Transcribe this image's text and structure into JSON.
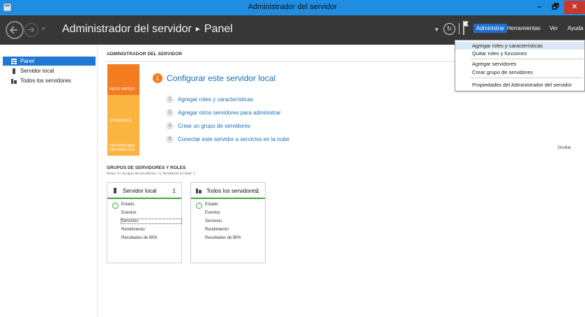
{
  "window": {
    "title": "Administrador del servidor"
  },
  "window_buttons": {
    "minimize": "–",
    "maximize": "🗗",
    "close": "✕"
  },
  "header": {
    "app_name": "Administrador del servidor",
    "separator": "▸",
    "page": "Panel",
    "menus": [
      "Administrar",
      "Herramientas",
      "Ver",
      "Ayuda"
    ]
  },
  "dropdown": {
    "items": [
      "Agregar roles y características",
      "Quitar roles y funciones",
      "Agregar servidores",
      "Crear grupo de servidores",
      "Propiedades del Administrador del servidor"
    ]
  },
  "sidebar": {
    "items": [
      {
        "label": "Panel",
        "icon": "dashboard-icon"
      },
      {
        "label": "Servidor local",
        "icon": "server-icon"
      },
      {
        "label": "Todos los servidores",
        "icon": "servers-icon"
      }
    ]
  },
  "main": {
    "title": "ADMINISTRADOR DEL SERVIDOR",
    "quick_start": {
      "tabs": [
        "INICIO RÁPIDO",
        "NOVEDADES",
        "OBTENER MÁS INFORMACIÓN"
      ],
      "main_step": {
        "num": "1",
        "label": "Configurar este servidor local"
      },
      "steps": [
        {
          "num": "2",
          "label": "Agregar roles y características"
        },
        {
          "num": "3",
          "label": "Agregar otros servidores para administrar"
        },
        {
          "num": "4",
          "label": "Crear un grupo de servidores"
        },
        {
          "num": "5",
          "label": "Conectar este servidor a servicios en la nube"
        }
      ],
      "hide": "Ocultar"
    },
    "groups": {
      "title": "GRUPOS DE SERVIDORES Y ROLES",
      "subtitle": "Roles: 4  |  Grupos de servidores: 1  |  Servidores en total: 1",
      "tiles": [
        {
          "name": "Servidor local",
          "count": "1",
          "icon": "server-icon",
          "rows": [
            "Estado",
            "Eventos",
            "Servicios",
            "Rendimiento",
            "Resultados de BPA"
          ]
        },
        {
          "name": "Todos los servidores",
          "count": "1",
          "icon": "servers-icon",
          "rows": [
            "Estado",
            "Eventos",
            "Servicios",
            "Rendimiento",
            "Resultados de BPA"
          ]
        }
      ]
    }
  },
  "colors": {
    "accent": "#1e78d4",
    "orange": "#f47b20",
    "yellow": "#fbb43f",
    "green": "#3ea63e",
    "titlebar": "#1f8ee0",
    "header": "#373737"
  }
}
